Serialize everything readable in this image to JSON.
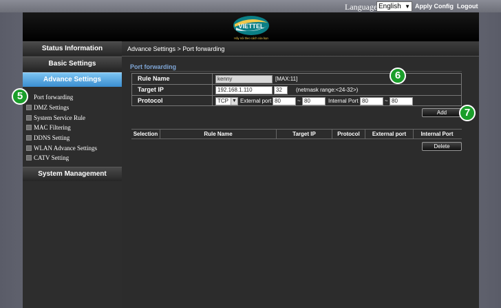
{
  "topbar": {
    "language_label": "Language",
    "language_value": "English",
    "apply_config": "Apply Config",
    "logout": "Logout"
  },
  "header": {
    "brand": "VIETTEL",
    "slogan": "Hãy nói theo cách của bạn"
  },
  "sidebar": {
    "status_information": "Status Information",
    "basic_settings": "Basic Settings",
    "advance_settings": "Advance Settings",
    "sub_items": [
      "Port forwarding",
      "DMZ Settings",
      "System Service Rule",
      "MAC Filtering",
      "DDNS Setting",
      "WLAN Advance Settings",
      "CATV Setting"
    ],
    "system_management": "System Management"
  },
  "content": {
    "breadcrumb": "Advance Settings > Port forwarding",
    "section_title": "Port forwarding",
    "form": {
      "rule_name_label": "Rule Name",
      "rule_name_value": "kenny",
      "rule_name_hint": "[MAX:11]",
      "target_ip_label": "Target IP",
      "target_ip_value": "192.168.1.110",
      "netmask_value": "32",
      "netmask_hint": "(netmask range:<24-32>)",
      "protocol_label": "Protocol",
      "protocol_value": "TCP",
      "external_port_label": "External port",
      "external_port_from": "80",
      "external_port_to": "80",
      "internal_port_label": "Internal Port",
      "internal_port_from": "80",
      "internal_port_to": "80",
      "tilde": "~"
    },
    "add_button": "Add",
    "list_headers": [
      "Selection",
      "Rule Name",
      "Target IP",
      "Protocol",
      "External port",
      "Internal Port"
    ],
    "delete_button": "Delete"
  },
  "badges": {
    "step5": "5",
    "step6": "6",
    "step7": "7"
  },
  "colors": {
    "accent_blue": "#3a8dd0",
    "section_title": "#7fa6d6",
    "badge_green": "#1a9e2a"
  }
}
